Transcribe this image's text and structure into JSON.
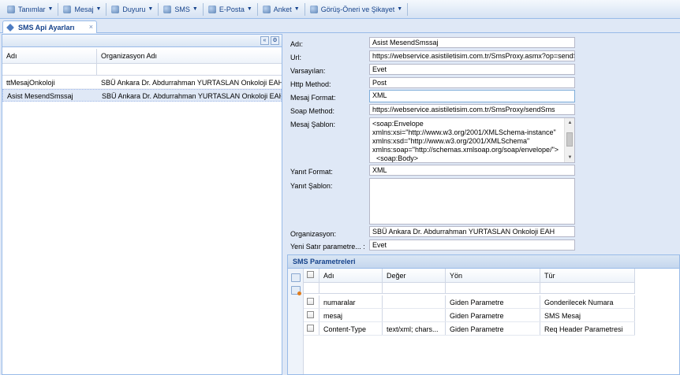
{
  "menu": [
    {
      "label": "Tanımlar",
      "icon": "folder-icon"
    },
    {
      "label": "Mesaj",
      "icon": "mail-icon"
    },
    {
      "label": "Duyuru",
      "icon": "announcement-icon"
    },
    {
      "label": "SMS",
      "icon": "phone-icon"
    },
    {
      "label": "E-Posta",
      "icon": "email-icon"
    },
    {
      "label": "Anket",
      "icon": "survey-icon"
    },
    {
      "label": "Görüş-Öneri ve Şikayet",
      "icon": "feedback-icon"
    }
  ],
  "tab": {
    "label": "SMS Api Ayarları",
    "close": "×"
  },
  "left_grid": {
    "headers": [
      "Adı",
      "Organizasyon Adı"
    ],
    "rows": [
      {
        "name": "ttMesajOnkoloji",
        "org": "SBÜ Ankara Dr. Abdurrahman YURTASLAN Onkoloji EAH"
      },
      {
        "name": "Asist MesendSmssaj",
        "org": "SBÜ Ankara Dr. Abdurrahman YURTASLAN Onkoloji EAH"
      }
    ]
  },
  "form": {
    "adi": {
      "label": "Adı:",
      "value": "Asist MesendSmssaj"
    },
    "url": {
      "label": "Url:",
      "value": "https://webservice.asistiletisim.com.tr/SmsProxy.asmx?op=sendS"
    },
    "varsayilan": {
      "label": "Varsayılan:",
      "value": "Evet"
    },
    "http_method": {
      "label": "Http Method:",
      "value": "Post"
    },
    "mesaj_format": {
      "label": "Mesaj Format:",
      "value": "XML"
    },
    "soap_method": {
      "label": "Soap Method:",
      "value": "https://webservice.asistiletisim.com.tr/SmsProxy/sendSms"
    },
    "mesaj_sablon": {
      "label": "Mesaj Şablon:",
      "lines": [
        "<soap:Envelope",
        "xmlns:xsi=\"http://www.w3.org/2001/XMLSchema-instance\"",
        "xmlns:xsd=\"http://www.w3.org/2001/XMLSchema\"",
        "xmlns:soap=\"http://schemas.xmlsoap.org/soap/envelope/\">",
        "  <soap:Body>"
      ]
    },
    "yanit_format": {
      "label": "Yanıt Format:",
      "value": "XML"
    },
    "yanit_sablon": {
      "label": "Yanıt Şablon:",
      "value": ""
    },
    "organizasyon": {
      "label": "Organizasyon:",
      "value": "SBÜ Ankara Dr. Abdurrahman YURTASLAN Onkoloji EAH"
    },
    "yeni_satir": {
      "label": "Yeni Satır parametre... :",
      "value": "Evet"
    }
  },
  "sms_params": {
    "title": "SMS Parametreleri",
    "headers": [
      "Adı",
      "Değer",
      "Yön",
      "Tür"
    ],
    "rows": [
      {
        "adi": "numaralar",
        "deger": "",
        "yon": "Giden Parametre",
        "tur": "Gonderilecek Numara"
      },
      {
        "adi": "mesaj",
        "deger": "",
        "yon": "Giden Parametre",
        "tur": "SMS Mesaj"
      },
      {
        "adi": "Content-Type",
        "deger": "text/xml; chars...",
        "yon": "Giden Parametre",
        "tur": "Req Header Parametresi"
      }
    ]
  }
}
